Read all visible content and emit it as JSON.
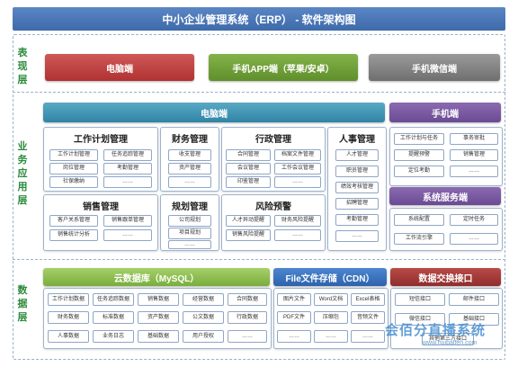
{
  "title": "中小企业管理系统（ERP） - 软件架构图",
  "layers": {
    "presentation": [
      "表",
      "现",
      "层"
    ],
    "business": [
      "业",
      "务",
      "应",
      "用",
      "层"
    ],
    "data": [
      "数",
      "据",
      "层"
    ]
  },
  "presentation": {
    "pc": "电脑端",
    "app": "手机APP端（苹果/安卓）",
    "wechat": "手机微信端"
  },
  "business": {
    "pc_bar": "电脑端",
    "mobile_bar": "手机端",
    "service_bar": "系统服务端",
    "work_plan": {
      "title": "工作计划管理",
      "items": [
        "工作计划管理",
        "任务追踪管理",
        "岗位管理",
        "考勤管理",
        "社保缴纳",
        "……"
      ]
    },
    "finance": {
      "title": "财务管理",
      "items": [
        "收支管理",
        "资产管理",
        "……"
      ]
    },
    "admin": {
      "title": "行政管理",
      "items": [
        "合同管理",
        "档案文件管理",
        "会议管理",
        "工作会议管理",
        "印鉴管理",
        "……"
      ]
    },
    "hr": {
      "title": "人事管理",
      "items": [
        "人才管理",
        "职员管理",
        "绩效考核管理",
        "招聘管理",
        "考勤管理",
        "……"
      ]
    },
    "sales": {
      "title": "销售管理",
      "items": [
        "客户关系管理",
        "销售跟单管理",
        "销售统计分析",
        "……"
      ]
    },
    "planning": {
      "title": "规划管理",
      "items": [
        "公司规划",
        "项目规划",
        "……"
      ]
    },
    "risk": {
      "title": "风险预警",
      "items": [
        "人才异动提醒",
        "财务风险提醒",
        "销售风险提醒",
        "……"
      ]
    },
    "mobile": {
      "items": [
        "工作计划与任务",
        "事务审批",
        "提醒预警",
        "销售管理",
        "定位考勤",
        "……"
      ]
    },
    "service": {
      "items": [
        "系统配置",
        "定时任务",
        "工作流引擎",
        "……"
      ]
    }
  },
  "data": {
    "cloud": {
      "title": "云数据库（MySQL）",
      "items": [
        "工作计划数据",
        "任务追踪数据",
        "销售数据",
        "经营数据",
        "合同数据",
        "财务数据",
        "标准数据",
        "资产数据",
        "公文数据",
        "行政数据",
        "人事数据",
        "业务日志",
        "基础数据",
        "用户授权",
        "……"
      ]
    },
    "file": {
      "title": "File文件存储（CDN）",
      "items": [
        "图片文件",
        "Word文档",
        "Excel表格",
        "PDF文件",
        "压缩包",
        "音频文件",
        "……",
        "……",
        "……"
      ]
    },
    "exchange": {
      "title": "数据交换接口",
      "items": [
        "短信接口",
        "邮件接口",
        "微信接口",
        "基础接口",
        "其他第三方接口"
      ]
    }
  },
  "watermark": {
    "text": "会佰分直播系统",
    "url": "www.huibaifen.com"
  }
}
